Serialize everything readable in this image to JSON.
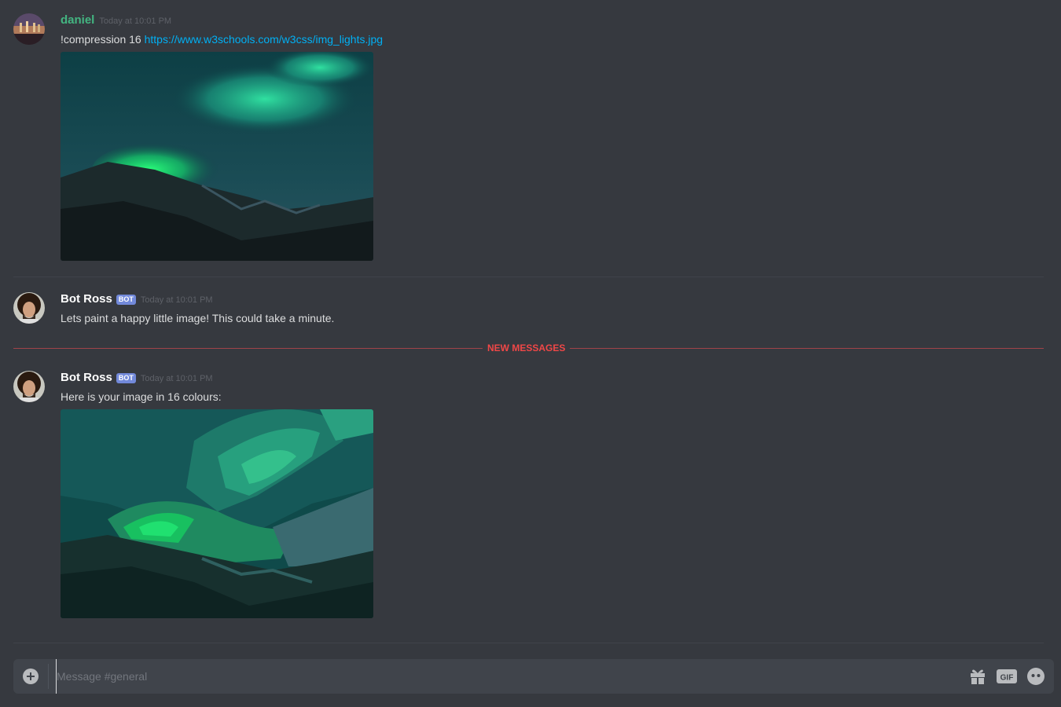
{
  "channel": "general",
  "messages": [
    {
      "username": "daniel",
      "timestamp": "Today at 10:01 PM",
      "text": "!compression 16 ",
      "link": "https://www.w3schools.com/w3css/img_lights.jpg",
      "attachment": "aurora-original"
    },
    {
      "username": "Bot Ross",
      "bot_tag": "BOT",
      "timestamp": "Today at 10:01 PM",
      "text": "Lets paint a happy little image! This could take a minute."
    },
    {
      "username": "Bot Ross",
      "bot_tag": "BOT",
      "timestamp": "Today at 10:01 PM",
      "text": "Here is your image in 16 colours:",
      "attachment": "aurora-16-colours"
    }
  ],
  "new_messages_label": "NEW MESSAGES",
  "composer": {
    "placeholder": "Message #general",
    "icons": [
      "add-attachment-icon",
      "gift-icon",
      "gif-icon",
      "emoji-icon"
    ]
  },
  "colors": {
    "background": "#36393f",
    "username_green": "#43b581",
    "link": "#00b0f4",
    "bot_tag": "#7289da",
    "new_messages": "#f04747"
  }
}
